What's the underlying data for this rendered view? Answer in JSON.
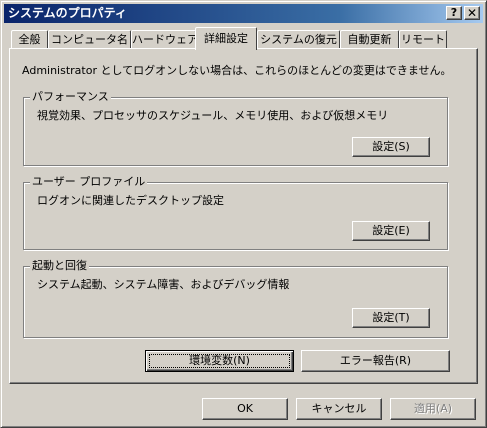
{
  "window": {
    "title": "システムのプロパティ",
    "help_label": "?",
    "close_label": "✕"
  },
  "tabs": [
    {
      "label": "全般",
      "active": false
    },
    {
      "label": "コンピュータ名",
      "active": false
    },
    {
      "label": "ハードウェア",
      "active": false
    },
    {
      "label": "詳細設定",
      "active": true
    },
    {
      "label": "システムの復元",
      "active": false
    },
    {
      "label": "自動更新",
      "active": false
    },
    {
      "label": "リモート",
      "active": false
    }
  ],
  "intro_text": "Administrator としてログオンしない場合は、これらのほとんどの変更はできません。",
  "groups": {
    "performance": {
      "label": "パフォーマンス",
      "description": "視覚効果、プロセッサのスケジュール、メモリ使用、および仮想メモリ",
      "button": "設定(S)"
    },
    "user_profile": {
      "label": "ユーザー プロファイル",
      "description": "ログオンに関連したデスクトップ設定",
      "button": "設定(E)"
    },
    "startup_recovery": {
      "label": "起動と回復",
      "description": "システム起動、システム障害、およびデバッグ情報",
      "button": "設定(T)"
    }
  },
  "env_vars_button": "環境変数(N)",
  "error_report_button": "エラー報告(R)",
  "footer": {
    "ok": "OK",
    "cancel": "キャンセル",
    "apply": "適用(A)"
  }
}
